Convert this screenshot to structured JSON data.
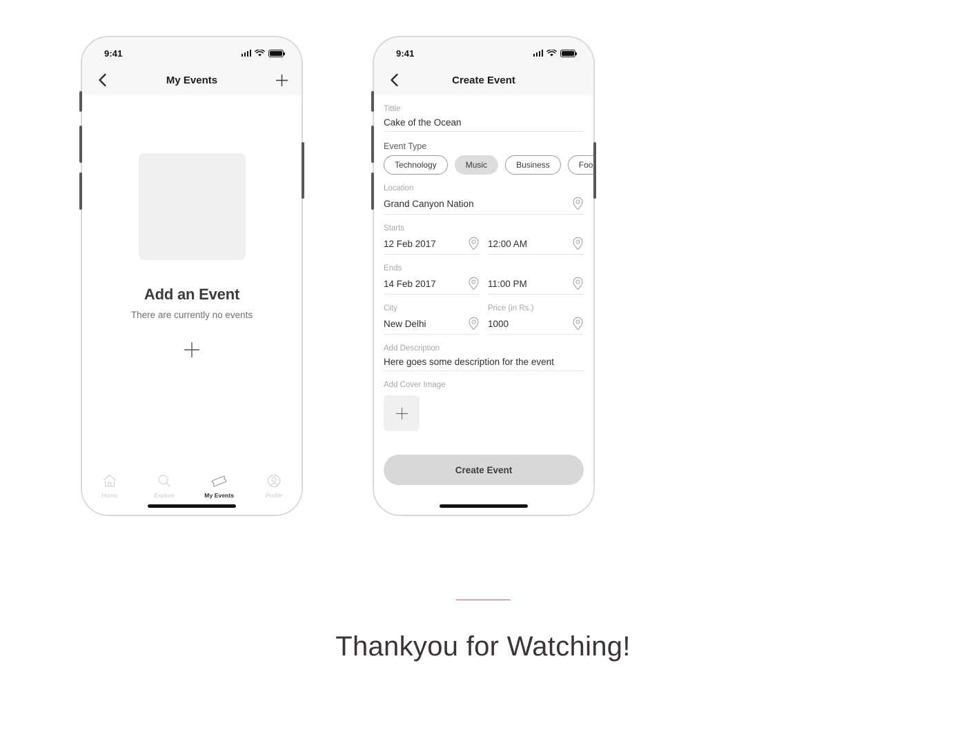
{
  "page": {
    "footer_heading": "Thankyou for Watching!",
    "divider_color": "#e05a5a",
    "background": "#ffffff"
  },
  "phone_left": {
    "status": {
      "time": "9:41",
      "signal_icon": "cellular-signal-icon",
      "wifi_icon": "wifi-icon",
      "battery_icon": "battery-full-icon"
    },
    "nav": {
      "back_icon": "chevron-left-icon",
      "title": "My Events",
      "action_icon": "plus-icon"
    },
    "empty_state": {
      "image_placeholder": "image-placeholder",
      "title": "Add an Event",
      "subtitle": "There are currently no events",
      "add_icon": "plus-icon"
    },
    "tabs": [
      {
        "label": "Home",
        "icon": "home-icon",
        "active": false
      },
      {
        "label": "Explore",
        "icon": "search-icon",
        "active": false
      },
      {
        "label": "My Events",
        "icon": "ticket-icon",
        "active": true
      },
      {
        "label": "Profile",
        "icon": "person-icon",
        "active": false
      }
    ]
  },
  "phone_right": {
    "status": {
      "time": "9:41",
      "signal_icon": "cellular-signal-icon",
      "wifi_icon": "wifi-icon",
      "battery_icon": "battery-full-icon"
    },
    "nav": {
      "back_icon": "chevron-left-icon",
      "title": "Create Event"
    },
    "form": {
      "title": {
        "label": "Tittle",
        "value": "Cake of the Ocean"
      },
      "event_type": {
        "label": "Event Type",
        "chips": [
          {
            "label": "Technology",
            "selected": false
          },
          {
            "label": "Music",
            "selected": true
          },
          {
            "label": "Business",
            "selected": false
          },
          {
            "label": "Food",
            "selected": false
          }
        ]
      },
      "location": {
        "label": "Location",
        "value": "Grand Canyon Nation",
        "icon": "map-pin-icon"
      },
      "starts": {
        "label": "Starts",
        "date": "12 Feb 2017",
        "time": "12:00 AM",
        "date_icon": "map-pin-icon",
        "time_icon": "map-pin-icon"
      },
      "ends": {
        "label": "Ends",
        "date": "14 Feb 2017",
        "time": "11:00 PM",
        "date_icon": "map-pin-icon",
        "time_icon": "map-pin-icon"
      },
      "city": {
        "label": "City",
        "value": "New Delhi",
        "icon": "map-pin-icon"
      },
      "price": {
        "label": "Price (in Rs.)",
        "value": "1000",
        "icon": "map-pin-icon"
      },
      "description": {
        "label": "Add Description",
        "value": "Here goes some description for the event"
      },
      "cover_image": {
        "label": "Add Cover Image",
        "add_icon": "plus-icon"
      },
      "submit": {
        "label": "Create Event"
      }
    }
  }
}
